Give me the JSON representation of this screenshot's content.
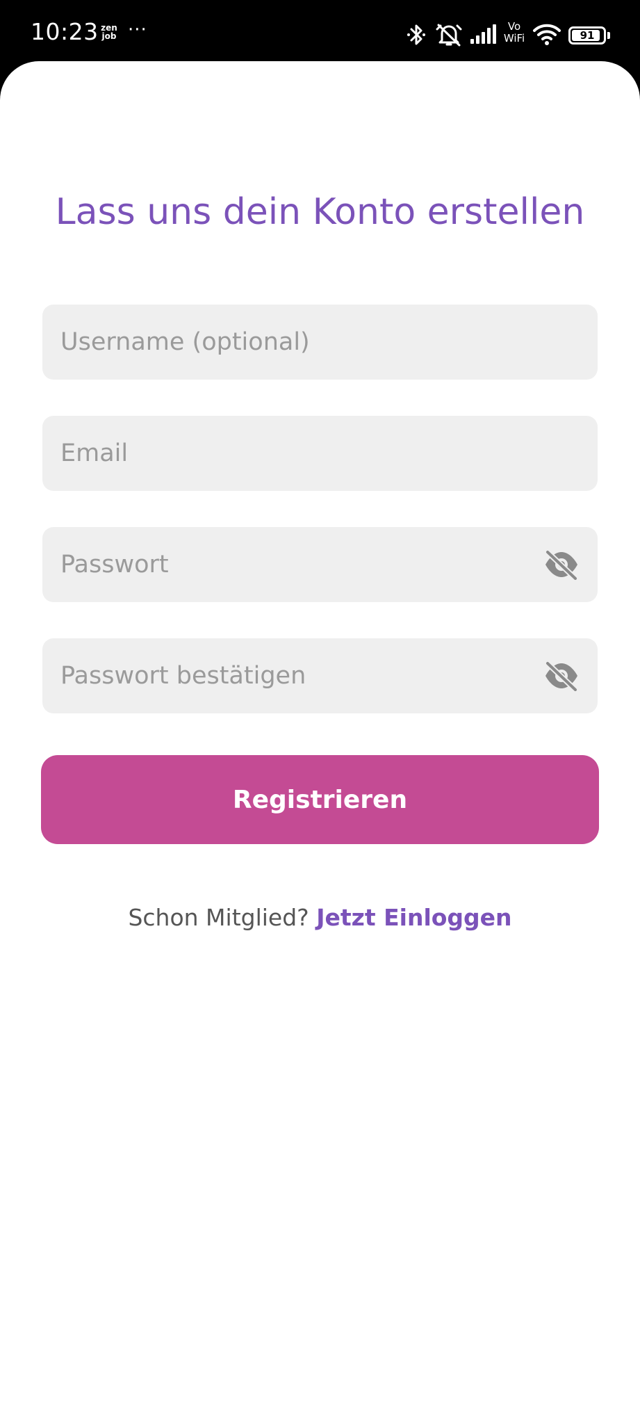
{
  "status_bar": {
    "time": "10:23",
    "app_badge_top": "zen",
    "app_badge_bottom": "job",
    "overflow_dots": "···",
    "vowifi_top": "Vo",
    "vowifi_bottom": "WiFi",
    "battery_level": "91",
    "battery_fraction": 0.91,
    "icons": [
      "bluetooth-icon",
      "alarm-off-icon",
      "cell-signal-icon",
      "vowifi-icon",
      "wifi-icon",
      "battery-icon"
    ]
  },
  "form": {
    "title": "Lass uns dein Konto erstellen",
    "username_placeholder": "Username (optional)",
    "username_value": "",
    "email_placeholder": "Email",
    "email_value": "",
    "password_placeholder": "Passwort",
    "password_value": "",
    "confirm_placeholder": "Passwort bestätigen",
    "confirm_value": "",
    "password_toggle_icon": "eye-off-icon",
    "submit_label": "Registrieren"
  },
  "footer": {
    "question": "Schon Mitglied?",
    "login_link": "Jetzt Einloggen"
  },
  "colors": {
    "accent_purple": "#7b52b9",
    "button_pink": "#c44b94",
    "field_background": "#efefef",
    "placeholder_gray": "#9a9a9a"
  }
}
